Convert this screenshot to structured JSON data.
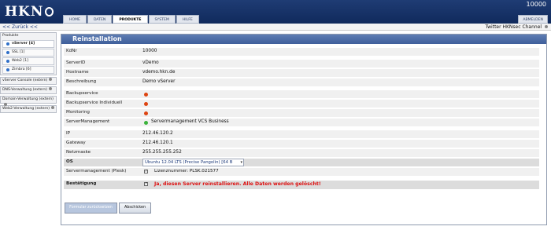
{
  "header": {
    "logo_text": "HKN",
    "account_number": "10000",
    "nav": [
      "HOME",
      "DATEN",
      "PRODUKTE",
      "SYSTEM",
      "HILFE"
    ],
    "active_nav": "PRODUKTE",
    "logout_label": "ABMELDEN"
  },
  "subbar": {
    "back_label": "<< Zurück <<",
    "twitter_label": "Twitter HKNsec Channel"
  },
  "sidebar": {
    "products_title": "Produkte",
    "products": [
      {
        "label": "vServer [4]",
        "active": true
      },
      {
        "label": "SSL [1]",
        "active": false
      },
      {
        "label": "Web2 [1]",
        "active": false
      },
      {
        "label": "Zimbra [6]",
        "active": false
      }
    ],
    "links": [
      "vServer Console (extern)",
      "DNS-Verwaltung (extern)",
      "Domain-Verwaltung (extern)",
      "Web2-Verwaltung (extern)"
    ]
  },
  "panel": {
    "title": "Reinstallation",
    "fields": {
      "kdnr_label": "KdNr",
      "kdnr_value": "10000",
      "serverid_label": "ServerID",
      "serverid_value": "vDemo",
      "hostname_label": "Hostname",
      "hostname_value": "vdemo.hkn.de",
      "beschreibung_label": "Beschreibung",
      "beschreibung_value": "Demo vServer",
      "backup_label": "Backupservice",
      "backup_ind_label": "Backupservice Individuell",
      "monitoring_label": "Monitoring",
      "servermgmt_label": "ServerManagement",
      "servermgmt_value": "Servermanagement VCS Business",
      "ip_label": "IP",
      "ip_value": "212.46.120.2",
      "gateway_label": "Gateway",
      "gateway_value": "212.46.120.1",
      "netmask_label": "Netzmaske",
      "netmask_value": "255.255.255.252",
      "os_label": "OS",
      "os_value": "Ubuntu 12.04 LTS (Precise Pangolin) [64 B",
      "plesk_label": "Servermanagement (Plesk)",
      "plesk_value": "Lizenznummer: PLSK.021577",
      "confirm_label": "Bestätigung",
      "confirm_text": "Ja, diesen Server reinstallieren. Alle Daten werden gelöscht!"
    },
    "buttons": {
      "reset_label": "Formular zurücksetzen",
      "send_label": "Abschicken"
    }
  },
  "colors": {
    "header_bg": "#1f3c74",
    "panel_title_bg": "#4f6ea8",
    "status_red": "#dd4411",
    "status_green": "#3bb33b",
    "confirm_red": "#dd1111"
  }
}
